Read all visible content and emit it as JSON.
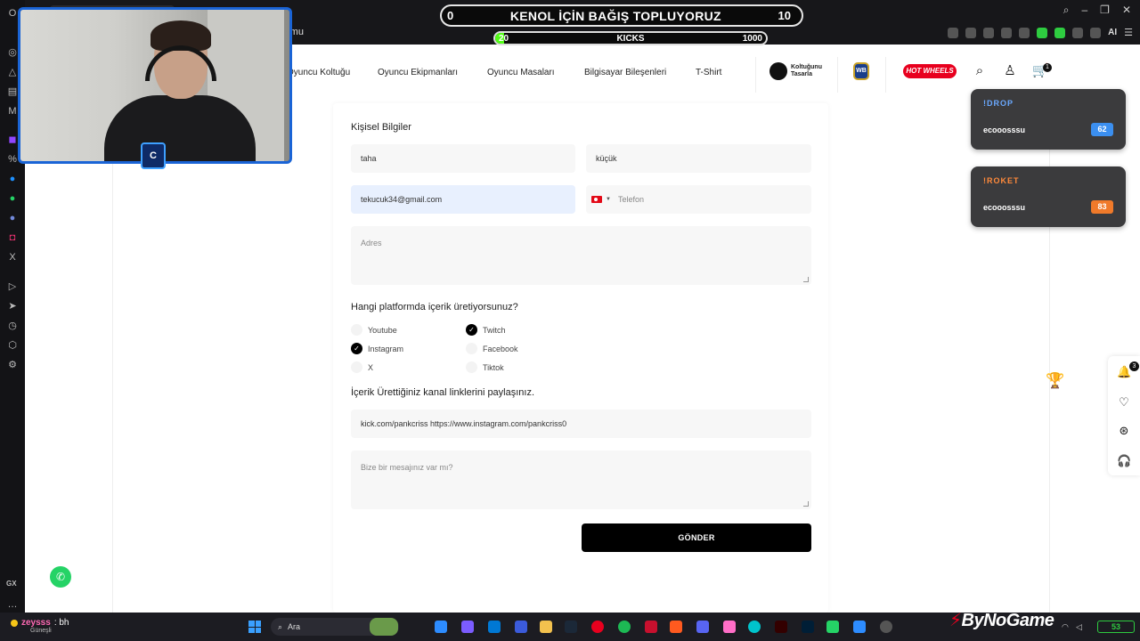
{
  "stream": {
    "goal_title": "KENOL İÇİN BAĞIŞ TOPLUYORUZ",
    "goal_current": "0",
    "goal_target": "10",
    "kicks_label": "KICKS",
    "kicks_current": "20",
    "kicks_target": "1000",
    "drop_cards": [
      {
        "title": "!DROP",
        "user": "ecooosssu",
        "score": "62",
        "title_color": "#6aa9ff",
        "score_color": "#3b8ff0"
      },
      {
        "title": "!ROKET",
        "user": "ecooosssu",
        "score": "83",
        "title_color": "#ff8a3b",
        "score_color": "#f07a2a"
      }
    ],
    "cam_logo": "C",
    "chat_user": "zeysss",
    "chat_msg": ": bh",
    "weather": "Güneşli"
  },
  "browser": {
    "address_fragment": "rmu",
    "ext_ai": "AI",
    "sidebar_gx": "GX"
  },
  "nav": {
    "links": [
      "Oyuncu Koltuğu",
      "Oyuncu Ekipmanları",
      "Oyuncu Masaları",
      "Bilgisayar Bileşenleri",
      "T-Shirt"
    ],
    "brand_koltugunu_line1": "Koltuğunu",
    "brand_koltugunu_line2": "Tasarla",
    "brand_wb": "WB",
    "brand_hw": "HOT WHEELS",
    "cart_count": "1"
  },
  "form": {
    "section_personal": "Kişisel Bilgiler",
    "first_name": "taha",
    "last_name": "küçük",
    "email": "tekucuk34@gmail.com",
    "phone_placeholder": "Telefon",
    "address_placeholder": "Adres",
    "platform_question": "Hangi platformda içerik üretiyorsunuz?",
    "platforms": [
      {
        "label": "Youtube",
        "checked": false
      },
      {
        "label": "Twitch",
        "checked": true
      },
      {
        "label": "Instagram",
        "checked": true
      },
      {
        "label": "Facebook",
        "checked": false
      },
      {
        "label": "X",
        "checked": false
      },
      {
        "label": "Tiktok",
        "checked": false
      }
    ],
    "links_question": "İçerik Ürettiğiniz kanal linklerini paylaşınız.",
    "links_value": "kick.com/pankcriss https://www.instagram.com/pankcriss0",
    "message_placeholder": "Bize bir mesajınız var mı?",
    "submit_label": "GÖNDER"
  },
  "floating": {
    "notif_count": "3"
  },
  "taskbar": {
    "search_label": "Ara",
    "brand": "ByNoGame",
    "battery": "53"
  }
}
